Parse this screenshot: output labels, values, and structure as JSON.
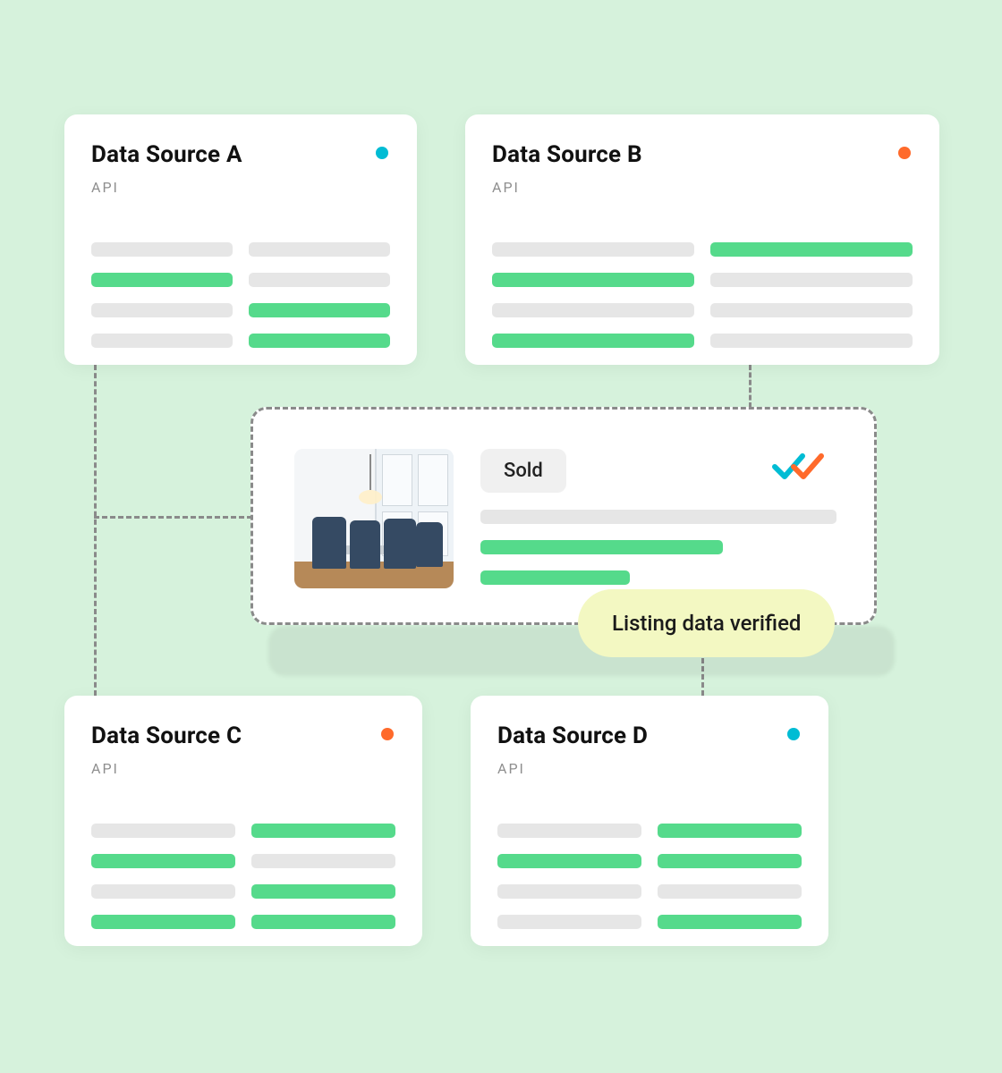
{
  "sources": {
    "a": {
      "title": "Data Source A",
      "sub": "API",
      "dot": "teal"
    },
    "b": {
      "title": "Data Source B",
      "sub": "API",
      "dot": "orange"
    },
    "c": {
      "title": "Data Source C",
      "sub": "API",
      "dot": "orange"
    },
    "d": {
      "title": "Data Source D",
      "sub": "API",
      "dot": "teal"
    }
  },
  "bar_patterns": {
    "a": [
      "grey",
      "grey",
      "green",
      "grey",
      "grey",
      "green",
      "grey",
      "green"
    ],
    "b": [
      "grey",
      "green",
      "green",
      "grey",
      "grey",
      "grey",
      "green",
      "grey"
    ],
    "c": [
      "grey",
      "green",
      "green",
      "grey",
      "grey",
      "green",
      "green",
      "green"
    ],
    "d": [
      "grey",
      "green",
      "green",
      "green",
      "grey",
      "grey",
      "grey",
      "green"
    ]
  },
  "listing": {
    "status_label": "Sold",
    "detail_bars": [
      "grey",
      "green",
      "green"
    ],
    "detail_widths": [
      "100%",
      "68%",
      "42%"
    ],
    "check_colors": {
      "teal": "#00bcd4",
      "orange": "#ff6a2b"
    }
  },
  "verification": {
    "label": "Listing data verified"
  }
}
